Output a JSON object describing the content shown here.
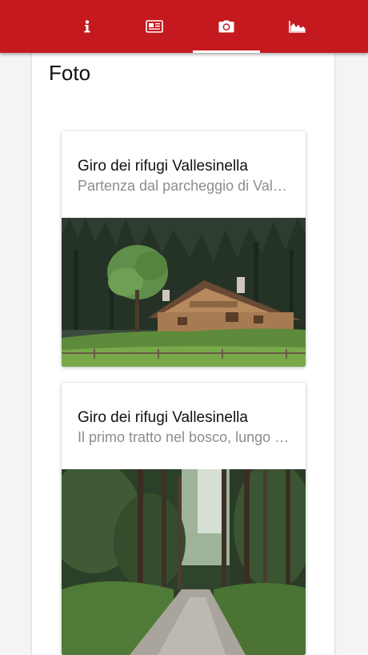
{
  "nav": {
    "tabs": [
      {
        "id": "info",
        "icon": "info-icon"
      },
      {
        "id": "news",
        "icon": "newspaper-icon"
      },
      {
        "id": "photos",
        "icon": "camera-icon",
        "active": true
      },
      {
        "id": "profile",
        "icon": "elevation-profile-icon"
      }
    ],
    "color": "#c41a1f"
  },
  "page": {
    "title": "Foto"
  },
  "photos": [
    {
      "title": "Giro dei rifugi Vallesinella",
      "subtitle": "Partenza dal parcheggio di Vallesinella",
      "image": "alpine-hut-meadow-photo"
    },
    {
      "title": "Giro dei rifugi Vallesinella",
      "subtitle": "Il primo tratto nel bosco, lungo la strada forestale",
      "image": "forest-trail-photo"
    }
  ]
}
